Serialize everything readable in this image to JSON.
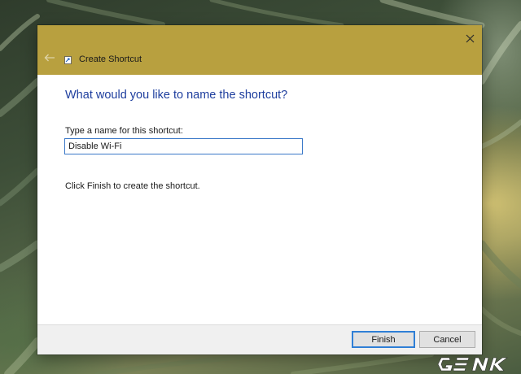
{
  "window": {
    "title": "Create Shortcut",
    "accent_color": "#b8a03f",
    "close_icon": "close-icon",
    "back_icon": "arrow-left-icon"
  },
  "content": {
    "heading": "What would you like to name the shortcut?",
    "name_label": "Type a name for this shortcut:",
    "name_value": "Disable Wi-Fi",
    "instruction": "Click Finish to create the shortcut."
  },
  "buttons": {
    "finish": "Finish",
    "cancel": "Cancel"
  },
  "watermark": {
    "text": "GENK"
  }
}
